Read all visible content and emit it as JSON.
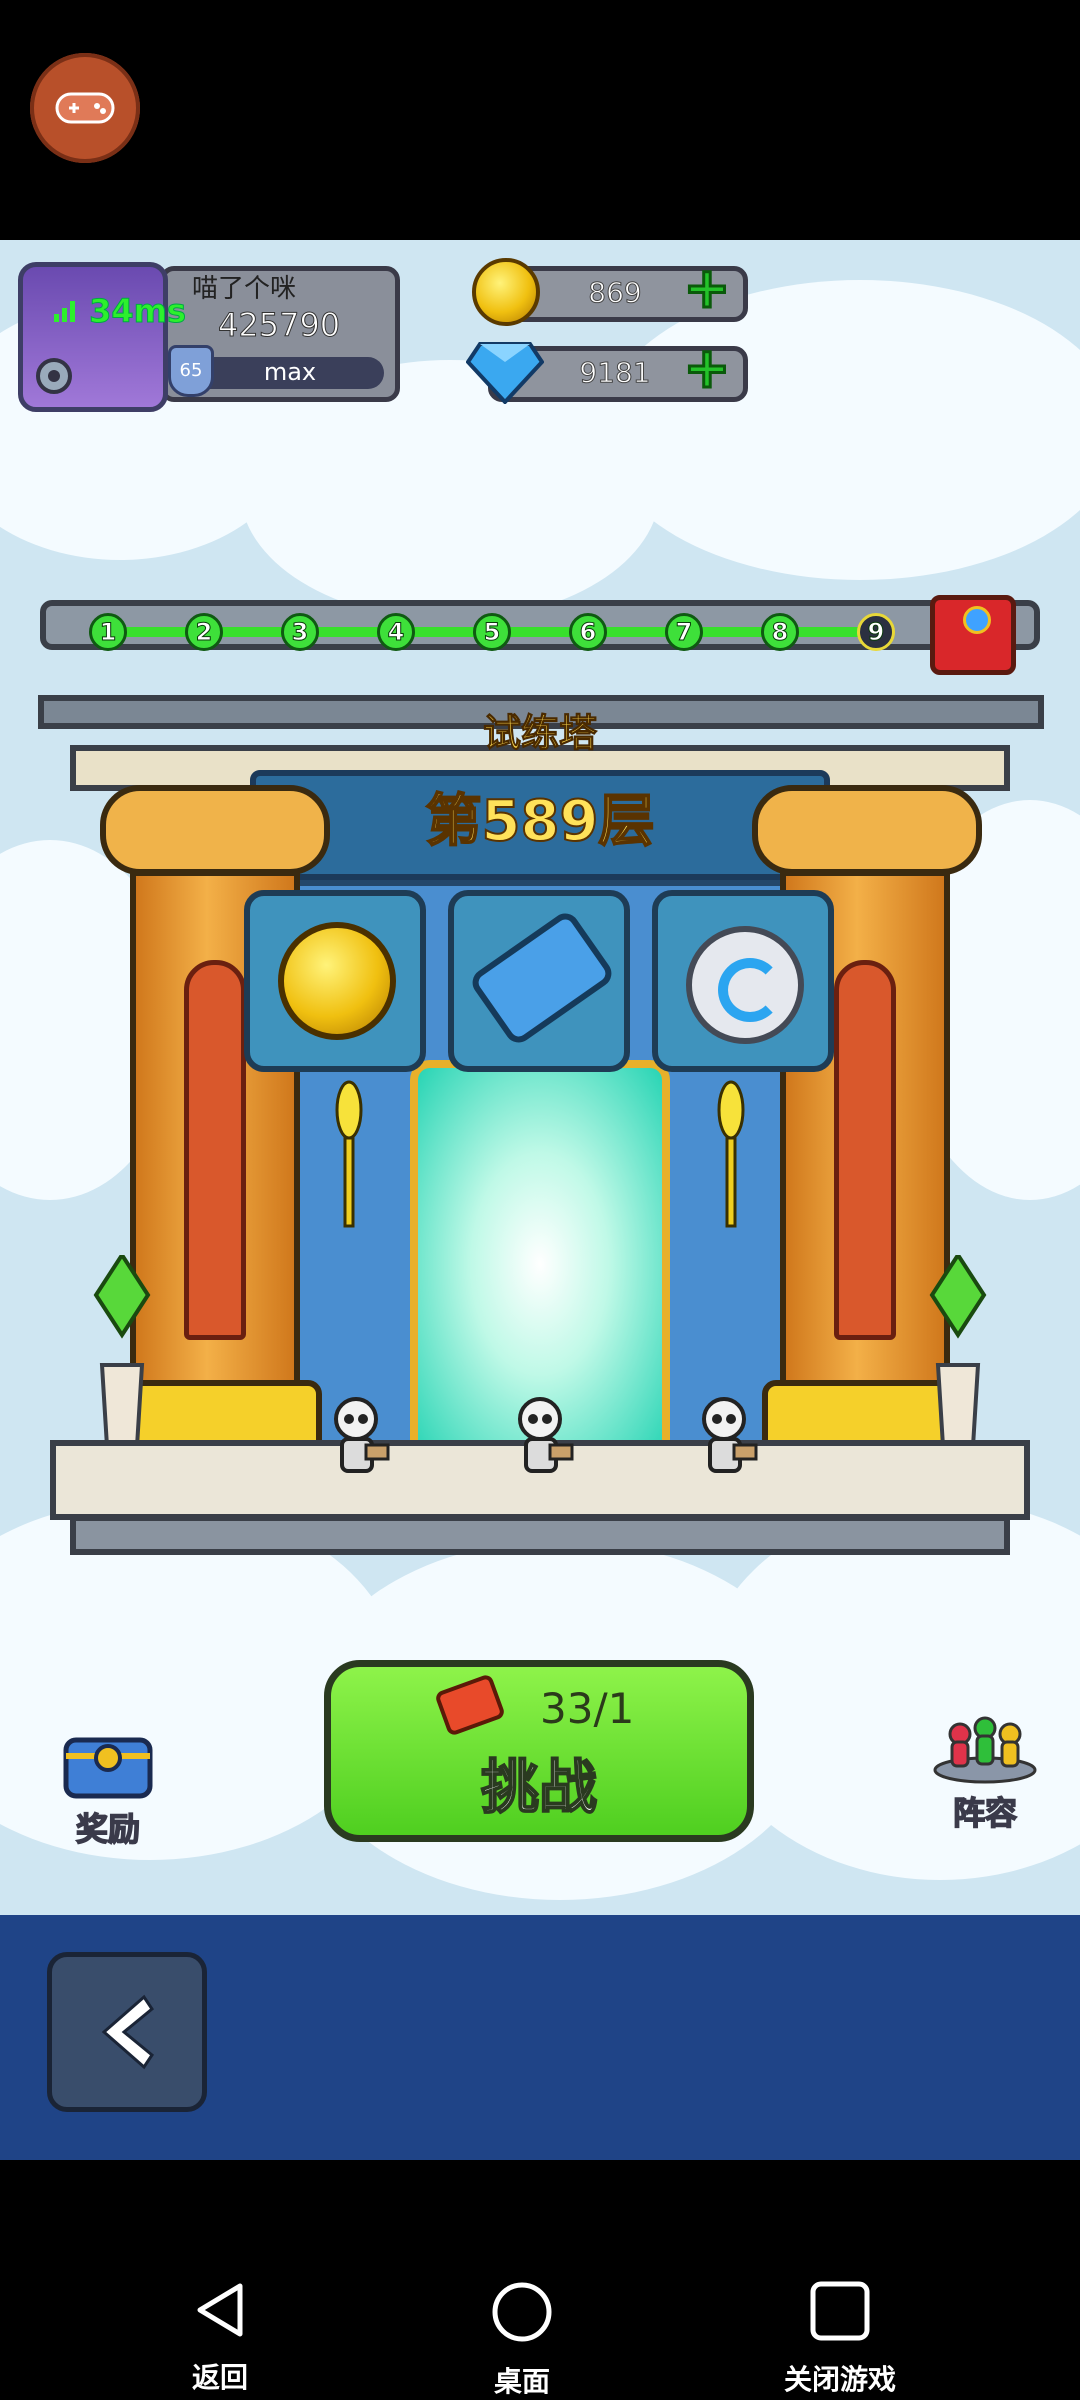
{
  "player": {
    "name": "喵了个咪",
    "power": "425790",
    "level": "65",
    "exp_label": "max",
    "ping": "34ms"
  },
  "resources": {
    "coins": "869",
    "gems": "9181"
  },
  "tower": {
    "name": "试练塔",
    "floor_label": "第589层",
    "progress_nodes": [
      "1",
      "2",
      "3",
      "4",
      "5",
      "6",
      "7",
      "8",
      "9"
    ],
    "current_node": "9",
    "rewards": [
      "coin",
      "ticket",
      "swirl"
    ]
  },
  "actions": {
    "challenge_count": "33/1",
    "challenge_label": "挑战",
    "reward_label": "奖励",
    "lineup_label": "阵容"
  },
  "system_nav": {
    "back_label": "返回",
    "home_label": "桌面",
    "close_label": "关闭游戏"
  },
  "colors": {
    "accent_green": "#4fcf20",
    "panel_blue": "#1f4487",
    "progress_green": "#38e02c",
    "title_gold": "#ffe25a"
  }
}
